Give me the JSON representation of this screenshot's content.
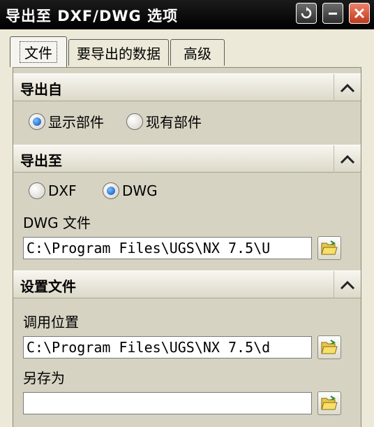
{
  "window": {
    "title": "导出至 DXF/DWG 选项"
  },
  "tabs": [
    {
      "label": "文件",
      "active": true
    },
    {
      "label": "要导出的数据",
      "active": false
    },
    {
      "label": "高级",
      "active": false
    }
  ],
  "export_from": {
    "title": "导出自",
    "options": [
      {
        "label": "显示部件",
        "selected": true
      },
      {
        "label": "现有部件",
        "selected": false
      }
    ]
  },
  "export_to": {
    "title": "导出至",
    "options": [
      {
        "label": "DXF",
        "selected": false
      },
      {
        "label": "DWG",
        "selected": true
      }
    ],
    "file_label": "DWG 文件",
    "file_value": "C:\\Program Files\\UGS\\NX 7.5\\U"
  },
  "settings_file": {
    "title": "设置文件",
    "load_label": "调用位置",
    "load_value": "C:\\Program Files\\UGS\\NX 7.5\\d",
    "save_as_label": "另存为",
    "save_as_value": ""
  }
}
